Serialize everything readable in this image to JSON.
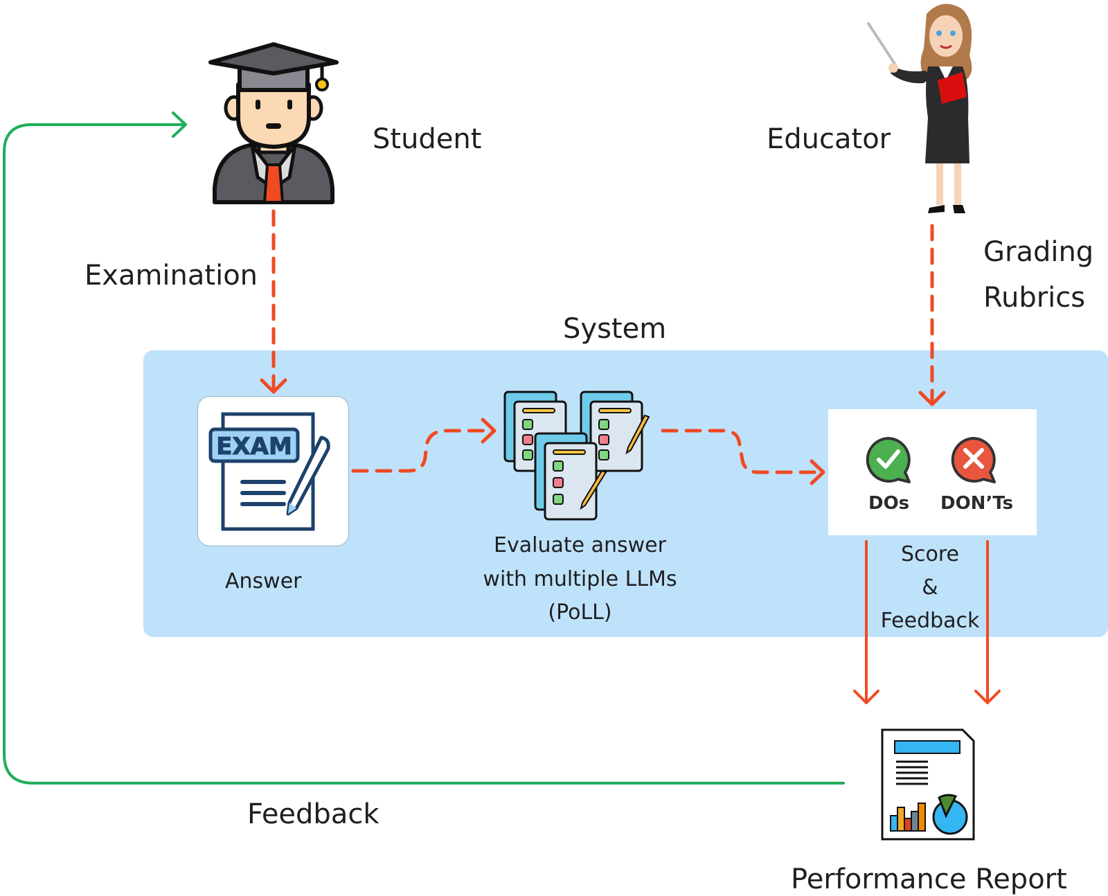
{
  "diagram": {
    "actors": {
      "student": {
        "label": "Student",
        "icon": "student-graduate-icon"
      },
      "educator": {
        "label": "Educator",
        "icon": "teacher-with-pointer-icon"
      }
    },
    "flows": {
      "examination": "Examination",
      "grading_rubrics_line1": "Grading",
      "grading_rubrics_line2": "Rubrics",
      "feedback_loop": "Feedback"
    },
    "system": {
      "title": "System",
      "answer": {
        "label": "Answer",
        "icon": "exam-paper-icon",
        "exam_text": "EXAM"
      },
      "evaluate": {
        "line1": "Evaluate answer",
        "line2": "with multiple LLMs",
        "line3": "(PoLL)",
        "icon": "checklist-documents-icon"
      },
      "rubric": {
        "dos_label": "DOs",
        "donts_label": "DON’Ts",
        "dos_icon": "check-bubble-icon",
        "donts_icon": "cross-bubble-icon"
      },
      "score": {
        "line1": "Score",
        "line2": "&",
        "line3": "Feedback"
      }
    },
    "report": {
      "label": "Performance Report",
      "icon": "report-chart-icon"
    },
    "colors": {
      "system_bg": "#bfe2fb",
      "dashed_arrow": "#f04a23",
      "feedback_arrow": "#1fae5b",
      "exam_navy": "#1d426b",
      "do_green": "#4caf50",
      "dont_red": "#e8563f"
    }
  }
}
